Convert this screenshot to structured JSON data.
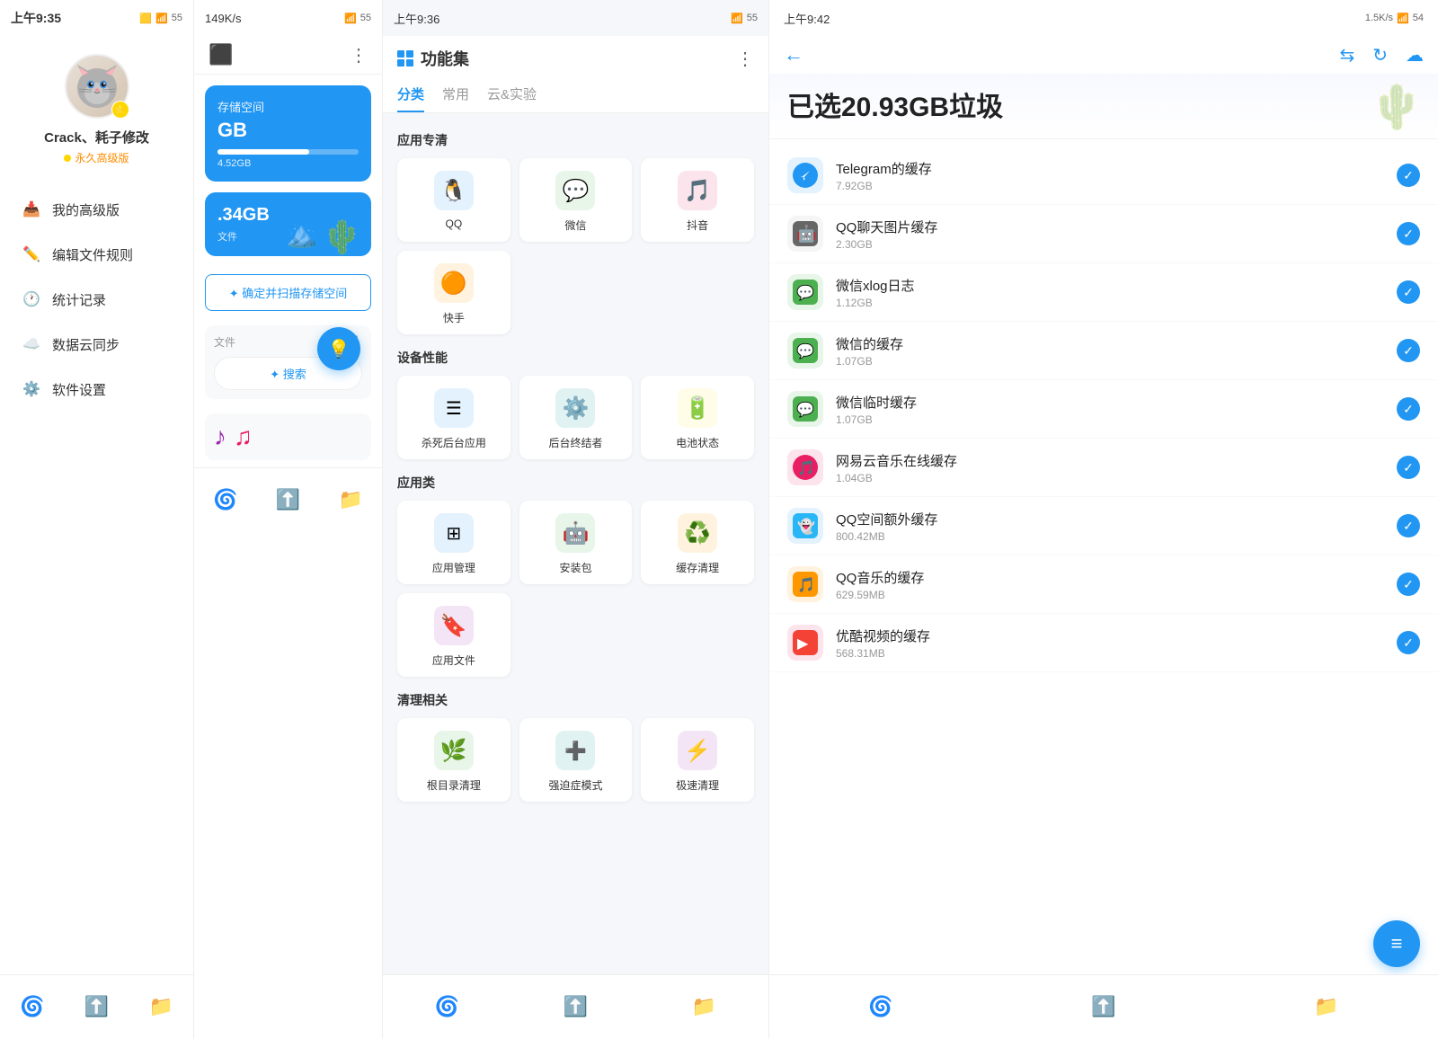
{
  "panel1": {
    "status": {
      "time": "上午9:35",
      "battery": "55"
    },
    "user": {
      "name": "Crack、耗子修改",
      "vip": "永久高级版",
      "star": "⭐"
    },
    "menu": [
      {
        "id": "my-premium",
        "icon": "📥",
        "label": "我的高级版",
        "color": "blue"
      },
      {
        "id": "edit-rules",
        "icon": "✏️",
        "label": "编辑文件规则",
        "color": "orange"
      },
      {
        "id": "stats",
        "icon": "🕐",
        "label": "统计记录",
        "color": "green"
      },
      {
        "id": "cloud-sync",
        "icon": "☁️",
        "label": "数据云同步",
        "color": "teal"
      },
      {
        "id": "settings",
        "icon": "⚙️",
        "label": "软件设置",
        "color": "gray"
      }
    ],
    "nav": [
      {
        "id": "clean",
        "icon": "🌀",
        "active": true
      },
      {
        "id": "move",
        "icon": "⬆️",
        "active": false
      },
      {
        "id": "folder",
        "icon": "📁",
        "active": false
      }
    ]
  },
  "panel2": {
    "status": {
      "time": "149K/s",
      "battery": "55"
    },
    "storage": {
      "title": "存储空间",
      "size": "GB",
      "used": "4.52GB",
      "progress": 65
    },
    "storage2": {
      "size": ".34GB",
      "label": "文件"
    },
    "confirm_btn": "确定并扫描存储空间",
    "file_section": {
      "label": "文件",
      "dots": "⋮",
      "search": "✦ 搜索"
    },
    "nav": [
      {
        "id": "clean",
        "icon": "🌀",
        "active": true
      },
      {
        "id": "move",
        "icon": "⬆️",
        "active": false
      },
      {
        "id": "folder",
        "icon": "📁",
        "active": false
      }
    ]
  },
  "panel3": {
    "status": {
      "time": "上午9:36",
      "battery": "55"
    },
    "title": "功能集",
    "more_icon": "⋮",
    "tabs": [
      {
        "id": "category",
        "label": "分类",
        "active": true
      },
      {
        "id": "common",
        "label": "常用",
        "active": false
      },
      {
        "id": "cloud",
        "label": "云&实验",
        "active": false
      }
    ],
    "sections": [
      {
        "title": "应用专清",
        "items": [
          {
            "id": "qq",
            "label": "QQ",
            "icon": "🐧",
            "bg": "blue"
          },
          {
            "id": "wechat",
            "label": "微信",
            "icon": "💬",
            "bg": "green"
          },
          {
            "id": "douyin",
            "label": "抖音",
            "icon": "🎵",
            "bg": "pink"
          },
          {
            "id": "kuaishou",
            "label": "快手",
            "icon": "🟠",
            "bg": "orange"
          }
        ]
      },
      {
        "title": "设备性能",
        "items": [
          {
            "id": "kill-bg",
            "label": "杀死后台应用",
            "icon": "☰",
            "bg": "blue"
          },
          {
            "id": "bg-killer",
            "label": "后台终结者",
            "icon": "⚙️",
            "bg": "teal"
          },
          {
            "id": "battery",
            "label": "电池状态",
            "icon": "🔋",
            "bg": "yellow"
          }
        ]
      },
      {
        "title": "应用类",
        "items": [
          {
            "id": "app-mgr",
            "label": "应用管理",
            "icon": "⊞",
            "bg": "blue"
          },
          {
            "id": "apk",
            "label": "安装包",
            "icon": "🤖",
            "bg": "green"
          },
          {
            "id": "cache-clean",
            "label": "缓存清理",
            "icon": "♻️",
            "bg": "orange"
          },
          {
            "id": "app-files",
            "label": "应用文件",
            "icon": "🔖",
            "bg": "purple"
          }
        ]
      },
      {
        "title": "清理相关",
        "items": [
          {
            "id": "dir-clean",
            "label": "根目录清理",
            "icon": "🌿",
            "bg": "green"
          },
          {
            "id": "ocd-mode",
            "label": "强迫症模式",
            "icon": "➕",
            "bg": "teal"
          },
          {
            "id": "fast-clean",
            "label": "极速清理",
            "icon": "⚡",
            "bg": "purple"
          }
        ]
      }
    ],
    "nav": [
      {
        "id": "clean",
        "icon": "🌀",
        "active": true
      },
      {
        "id": "move",
        "icon": "⬆️",
        "active": false
      },
      {
        "id": "folder",
        "icon": "📁",
        "active": false
      }
    ]
  },
  "panel4": {
    "status": {
      "time": "上午9:42",
      "speed": "1.5K/s",
      "battery": "54"
    },
    "actions": {
      "switch": "⇆",
      "refresh": "↻",
      "upload": "☁"
    },
    "hero": {
      "title": "已选20.93GB垃圾"
    },
    "items": [
      {
        "id": "telegram",
        "name": "Telegram的缓存",
        "size": "7.92GB",
        "icon": "✈️",
        "bg": "#E3F2FD",
        "color": "#2196F3"
      },
      {
        "id": "qq-chat",
        "name": "QQ聊天图片缓存",
        "size": "2.30GB",
        "icon": "🤖",
        "bg": "#f5f5f5",
        "color": "#666"
      },
      {
        "id": "wechat-xlog",
        "name": "微信xlog日志",
        "size": "1.12GB",
        "icon": "💬",
        "bg": "#E8F5E9",
        "color": "#4CAF50"
      },
      {
        "id": "wechat-cache",
        "name": "微信的缓存",
        "size": "1.07GB",
        "icon": "💬",
        "bg": "#E8F5E9",
        "color": "#4CAF50"
      },
      {
        "id": "wechat-tmp",
        "name": "微信临时缓存",
        "size": "1.07GB",
        "icon": "💬",
        "bg": "#E8F5E9",
        "color": "#4CAF50"
      },
      {
        "id": "netease",
        "name": "网易云音乐在线缓存",
        "size": "1.04GB",
        "icon": "🎵",
        "bg": "#FCE4EC",
        "color": "#E91E63"
      },
      {
        "id": "qq-space",
        "name": "QQ空间额外缓存",
        "size": "800.42MB",
        "icon": "👻",
        "bg": "#E3F2FD",
        "color": "#29B6F6"
      },
      {
        "id": "qq-music",
        "name": "QQ音乐的缓存",
        "size": "629.59MB",
        "icon": "🎵",
        "bg": "#FFF3E0",
        "color": "#FF9800"
      },
      {
        "id": "youku",
        "name": "优酷视频的缓存",
        "size": "568.31MB",
        "icon": "▶️",
        "bg": "#FCE4EC",
        "color": "#F44336"
      }
    ],
    "fab": "≡"
  }
}
